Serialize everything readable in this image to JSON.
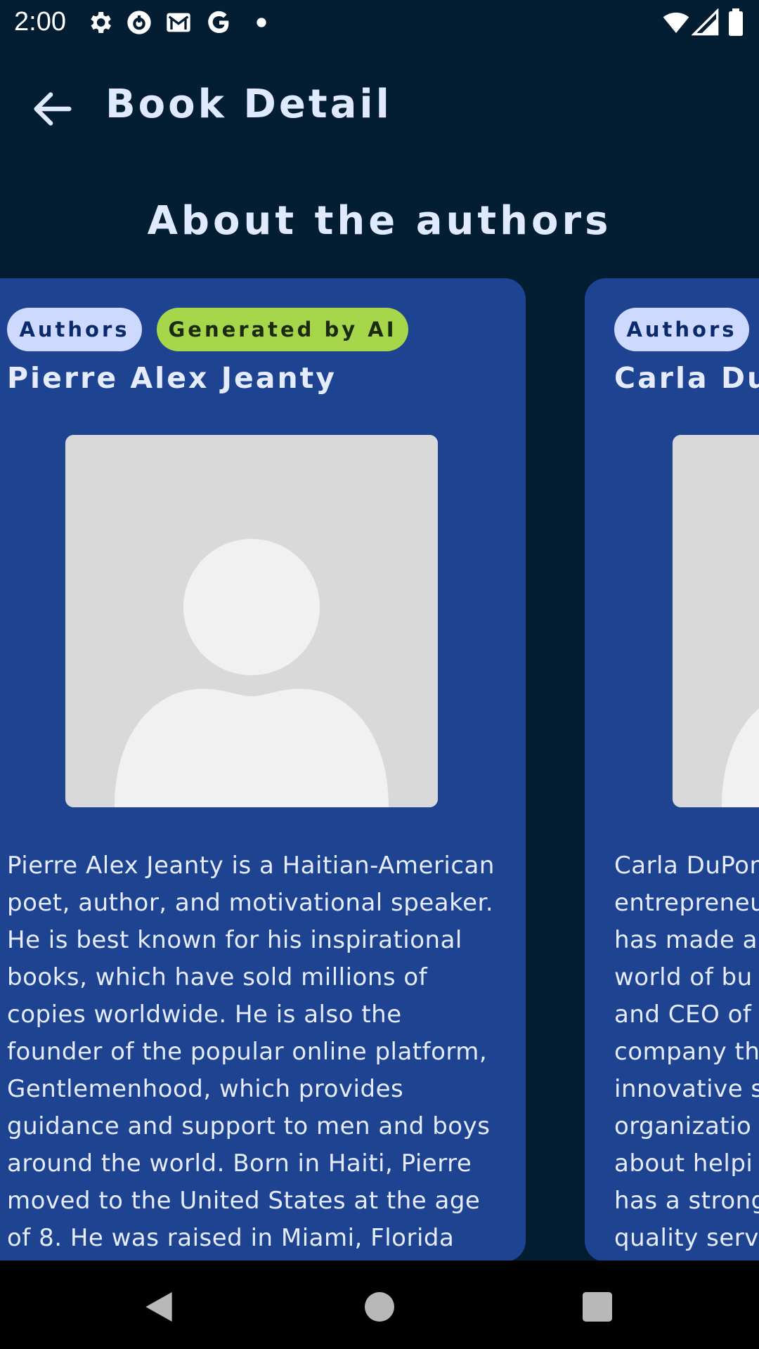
{
  "status_bar": {
    "time": "2:00",
    "left_icons": [
      "gear-icon",
      "cloud-sync-icon",
      "gmail-icon",
      "google-icon",
      "dot-icon"
    ],
    "right_icons": [
      "wifi-icon",
      "cellular-signal-icon",
      "battery-icon"
    ]
  },
  "header": {
    "title": "Book Detail",
    "back_icon": "arrow-left-icon"
  },
  "section": {
    "heading": "About the authors"
  },
  "authors": [
    {
      "tag_authors": "Authors",
      "tag_ai": "Generated by AI",
      "name": "Pierre Alex Jeanty",
      "avatar_icon": "person-placeholder-icon",
      "bio_lines": [
        "Pierre Alex Jeanty is a Haitian-American",
        "poet, author, and motivational speaker.",
        "He is best known for his inspirational",
        "books, which have sold millions of",
        "copies worldwide. He is also the",
        "founder of the popular online platform,",
        "Gentlemenhood, which provides",
        "guidance and support to men and boys",
        "around the world. Born in Haiti, Pierre",
        "moved to the United States at the age",
        "of 8. He was raised in Miami, Florida"
      ]
    },
    {
      "tag_authors": "Authors",
      "name": "Carla DuP",
      "avatar_icon": "person-placeholder-icon",
      "bio_lines": [
        "Carla DuPon",
        "entrepreneu",
        "has made a",
        "world of bu",
        "and CEO of",
        "company th",
        "innovative s",
        "organizatio",
        "about helpi",
        "has a strong",
        "quality serv"
      ]
    }
  ],
  "colors": {
    "background": "#031d33",
    "card": "#1e4390",
    "chip_authors": "#cdd9ff",
    "chip_ai": "#a6d64a"
  },
  "nav_bar": {
    "icons": [
      "back-triangle-icon",
      "home-circle-icon",
      "recents-square-icon"
    ]
  }
}
